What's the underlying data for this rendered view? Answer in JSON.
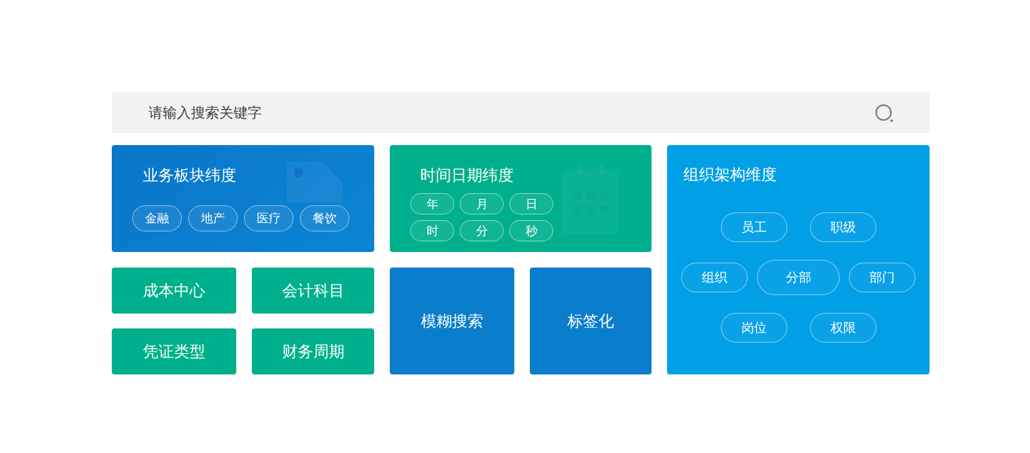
{
  "search": {
    "placeholder": "请输入搜索关键字"
  },
  "business_dimension": {
    "title": "业务板块纬度",
    "tags": [
      "金融",
      "地产",
      "医疗",
      "餐饮"
    ]
  },
  "finance_tiles": [
    "成本中心",
    "会计科目",
    "凭证类型",
    "财务周期"
  ],
  "time_dimension": {
    "title": "时间日期纬度",
    "tags": [
      "年",
      "月",
      "日",
      "时",
      "分",
      "秒"
    ]
  },
  "feature_tiles": [
    "模糊搜索",
    "标签化"
  ],
  "org_dimension": {
    "title": "组织架构维度",
    "tag_rows": [
      [
        {
          "label": "员工",
          "kind": "normal"
        },
        {
          "label": "职级",
          "kind": "normal"
        }
      ],
      [
        {
          "label": "组织",
          "kind": "normal"
        },
        {
          "label": "分部",
          "kind": "large"
        },
        {
          "label": "部门",
          "kind": "normal"
        }
      ],
      [
        {
          "label": "岗位",
          "kind": "normal"
        },
        {
          "label": "权限",
          "kind": "normal"
        }
      ]
    ]
  }
}
